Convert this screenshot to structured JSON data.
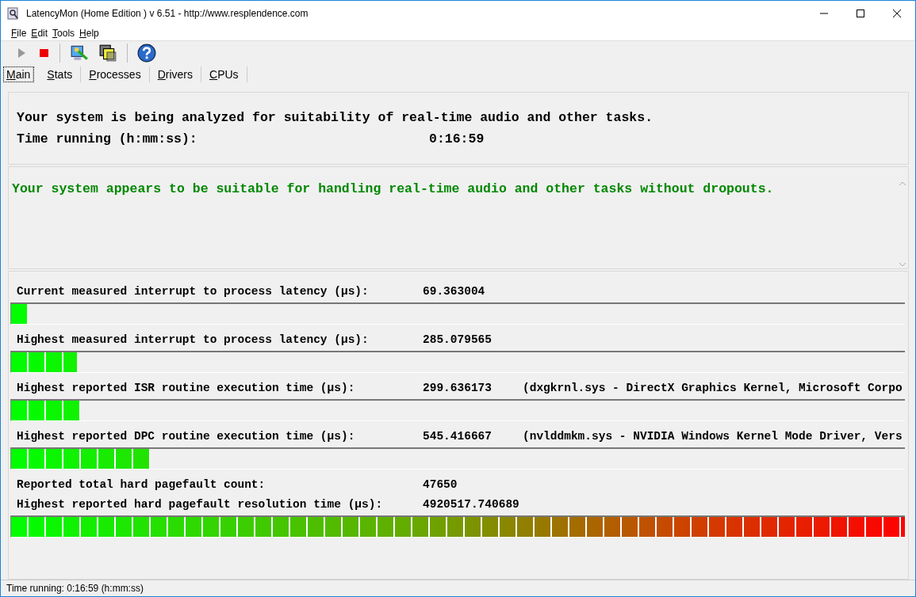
{
  "window": {
    "title": "LatencyMon  (Home Edition )  v 6.51 - http://www.resplendence.com"
  },
  "menu": [
    "File",
    "Edit",
    "Tools",
    "Help"
  ],
  "tabs": [
    {
      "label": "Main",
      "selected": true
    },
    {
      "label": "Stats",
      "selected": false
    },
    {
      "label": "Processes",
      "selected": false
    },
    {
      "label": "Drivers",
      "selected": false
    },
    {
      "label": "CPUs",
      "selected": false
    }
  ],
  "header": {
    "message": "Your system is being analyzed for suitability of real-time audio and other tasks.",
    "time_label": "Time running (h:mm:ss):",
    "time_value": "0:16:59"
  },
  "verdict": "Your system appears to be suitable for handling real-time audio and other tasks without dropouts.",
  "measurements": [
    {
      "kind": "meter",
      "label": "Current measured interrupt to process latency (µs):",
      "value": "69.363004",
      "level": 0.018
    },
    {
      "kind": "meter",
      "label": "Highest measured interrupt to process latency (µs):",
      "value": "285.079565",
      "level": 0.074
    },
    {
      "kind": "meter",
      "label": "Highest reported ISR routine execution time (µs):",
      "value": "299.636173",
      "detail": "(dxgkrnl.sys - DirectX Graphics Kernel, Microsoft Corpo",
      "level": 0.077
    },
    {
      "kind": "meter",
      "label": "Highest reported DPC routine execution time (µs):",
      "value": "545.416667",
      "detail": "(nvlddmkm.sys - NVIDIA Windows Kernel Mode Driver, Vers",
      "level": 0.155
    },
    {
      "kind": "text",
      "label": "Reported total hard pagefault count:",
      "value": "47650"
    },
    {
      "kind": "meter",
      "label": "Highest reported hard pagefault resolution time (µs):",
      "value": "4920517.740689",
      "level": 1.0
    }
  ],
  "status_bar": "Time running: 0:16:59  (h:mm:ss)"
}
